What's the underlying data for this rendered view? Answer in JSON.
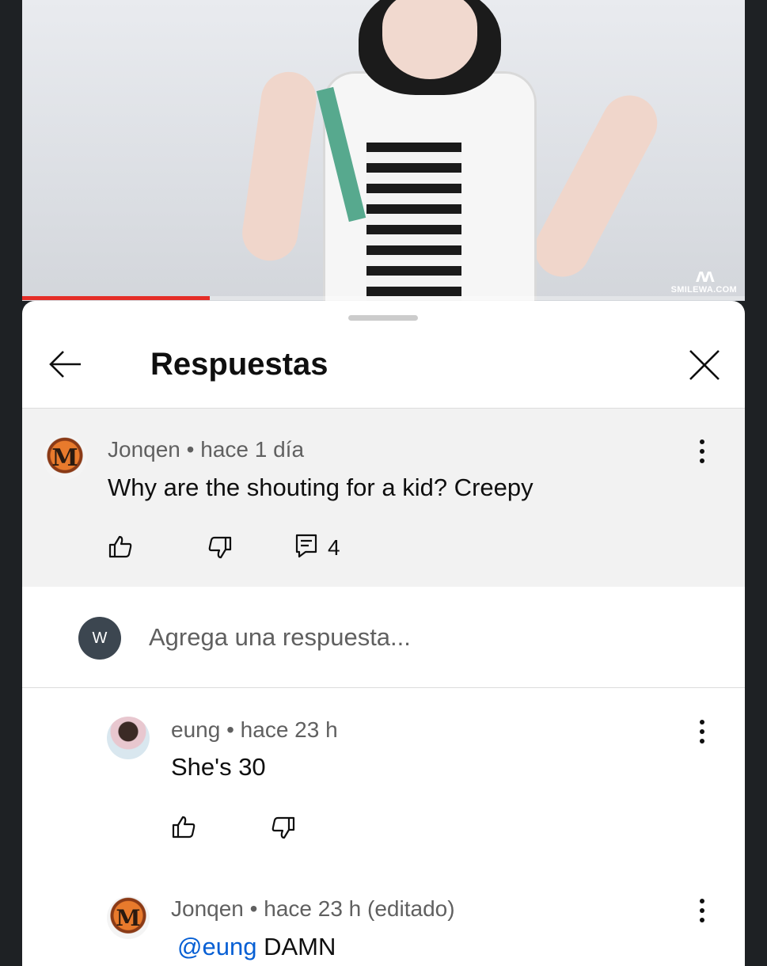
{
  "video": {
    "watermark": "SMILEWA.COM",
    "progress": 0.26
  },
  "header": {
    "title": "Respuestas",
    "back_icon": "arrow-left-icon",
    "close_icon": "close-icon"
  },
  "parent_comment": {
    "author": "Jonqen",
    "separator": "•",
    "time": "hace 1 día",
    "text": "Why are the shouting for a kid? Creepy",
    "reply_count": "4",
    "icons": [
      "thumbs-up-icon",
      "thumbs-down-icon",
      "comment-icon"
    ]
  },
  "reply_input": {
    "avatar_letter": "W",
    "placeholder": "Agrega una respuesta..."
  },
  "replies": [
    {
      "author": "eung",
      "separator": "•",
      "time": "hace 23 h",
      "text": "She's 30"
    },
    {
      "author": "Jonqen",
      "separator": "•",
      "time": "hace 23 h (editado)",
      "mention": "@eung",
      "text": "DAMN"
    }
  ],
  "colors": {
    "accent": "#e52d27",
    "link": "#065fd4",
    "meta_text": "#606060"
  }
}
